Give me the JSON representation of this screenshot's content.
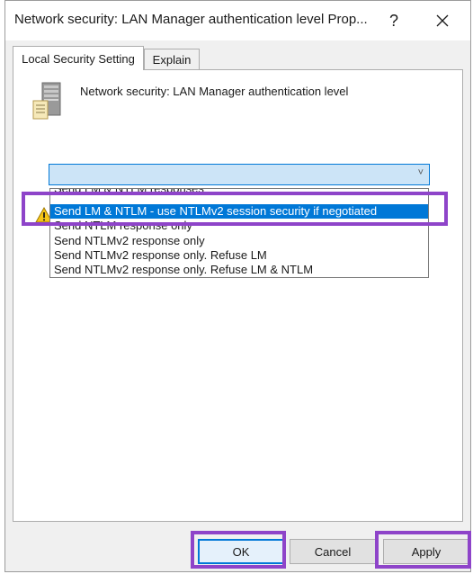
{
  "window": {
    "title": "Network security: LAN Manager authentication level Prop...",
    "help_glyph": "?",
    "close_glyph": "✕"
  },
  "tabs": [
    {
      "label": "Local Security Setting",
      "active": true
    },
    {
      "label": "Explain",
      "active": false
    }
  ],
  "policy": {
    "name": "Network security: LAN Manager authentication level",
    "icon": "server-policy-icon"
  },
  "combo": {
    "selected_value": "",
    "chevron": "˅"
  },
  "dropdown": {
    "options": [
      "Send LM & NTLM responses",
      "Send LM & NTLM - use NTLMv2 session security if negotiated",
      "Send NTLM response only",
      "Send NTLMv2 response only",
      "Send NTLMv2 response only. Refuse LM",
      "Send NTLMv2 response only. Refuse LM & NTLM"
    ],
    "selected_index": 1
  },
  "buttons": {
    "ok": "OK",
    "cancel": "Cancel",
    "apply": "Apply"
  },
  "colors": {
    "highlight": "#8e44c9",
    "selection": "#0078d7",
    "combo_fill": "#cce4f7"
  }
}
